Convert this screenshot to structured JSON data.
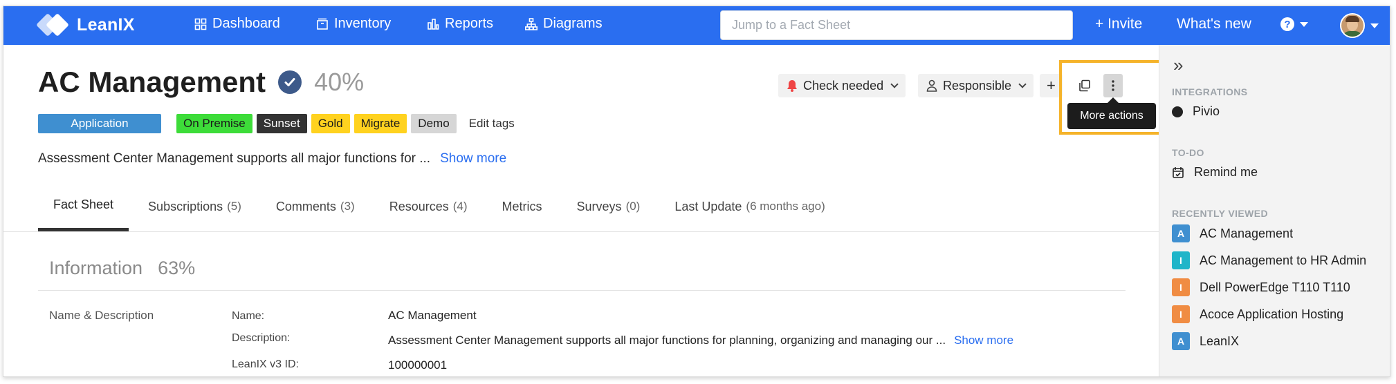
{
  "app": {
    "logo_text": "LeanIX"
  },
  "nav": {
    "dashboard": "Dashboard",
    "inventory": "Inventory",
    "reports": "Reports",
    "diagrams": "Diagrams",
    "search_placeholder": "Jump to a Fact Sheet",
    "invite": "+ Invite",
    "whats_new": "What's new",
    "help": "?"
  },
  "factsheet": {
    "title": "AC Management",
    "completion": "40%",
    "type_tag": "Application",
    "tags": [
      "On Premise",
      "Sunset",
      "Gold",
      "Migrate",
      "Demo"
    ],
    "edit_tags": "Edit tags",
    "description_short": "Assessment Center Management supports all major functions for ...",
    "show_more": "Show more"
  },
  "actions": {
    "check_needed": "Check needed",
    "responsible": "Responsible",
    "add": "+",
    "more_actions_tooltip": "More actions"
  },
  "tabs": [
    {
      "label": "Fact Sheet",
      "extra": ""
    },
    {
      "label": "Subscriptions",
      "extra": "(5)"
    },
    {
      "label": "Comments",
      "extra": "(3)"
    },
    {
      "label": "Resources",
      "extra": "(4)"
    },
    {
      "label": "Metrics",
      "extra": ""
    },
    {
      "label": "Surveys",
      "extra": "(0)"
    },
    {
      "label": "Last Update",
      "extra": "(6 months ago)"
    }
  ],
  "information": {
    "title": "Information",
    "completion": "63%",
    "section": "Name & Description",
    "name_label": "Name:",
    "name_value": "AC Management",
    "desc_label": "Description:",
    "desc_value": "Assessment Center Management supports all major functions for planning, organizing and managing our ...",
    "desc_more": "Show more",
    "id_label": "LeanIX v3 ID:",
    "id_value": "100000001"
  },
  "sidebar": {
    "expand": "»",
    "integrations_head": "INTEGRATIONS",
    "integration_item": "Pivio",
    "todo_head": "TO-DO",
    "todo_item": "Remind me",
    "recent_head": "RECENTLY VIEWED",
    "recent": [
      {
        "badge": "A",
        "label": "AC Management",
        "color": "#3f8fd0"
      },
      {
        "badge": "I",
        "label": "AC Management to HR Admin",
        "color": "#1fb5c9"
      },
      {
        "badge": "I",
        "label": "Dell PowerEdge T110 T110",
        "color": "#f08c43"
      },
      {
        "badge": "I",
        "label": "Acoce Application Hosting",
        "color": "#f08c43"
      },
      {
        "badge": "A",
        "label": "LeanIX",
        "color": "#3f8fd0"
      }
    ]
  }
}
